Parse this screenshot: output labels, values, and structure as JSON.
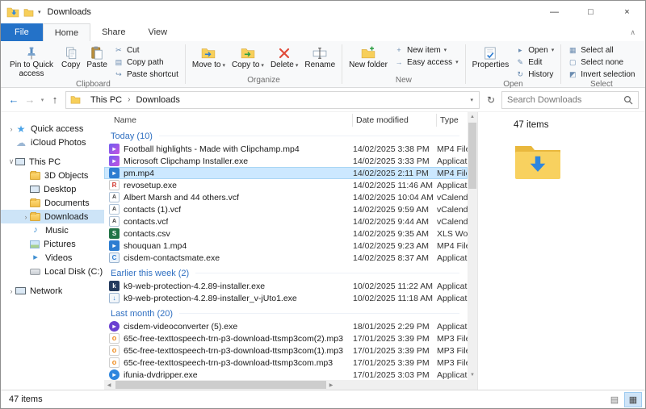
{
  "icons": {
    "dropdown": "▾",
    "crumb_sep": "›",
    "chevron_right": "›",
    "chevron_down": "∨",
    "back": "←",
    "forward": "→",
    "up": "↑",
    "refresh": "↻",
    "minimize": "—",
    "maximize": "□",
    "close": "×",
    "cut": "✂",
    "copy_path": "▤",
    "paste_shortcut": "↪",
    "new_item": "+",
    "easy_access": "→",
    "open": "▸",
    "edit": "✎",
    "history": "↻",
    "select_all": "▦",
    "select_none": "▢",
    "invert_selection": "◩",
    "scroll_up": "▲",
    "scroll_down": "▼",
    "scroll_left": "◀",
    "scroll_right": "▶",
    "ribbon_collapse": "∧",
    "details_view": "▤",
    "thumbnails_view": "▦"
  },
  "titlebar": {
    "title": "Downloads"
  },
  "tabs": {
    "file": "File",
    "items": [
      {
        "label": "Home",
        "active": true
      },
      {
        "label": "Share"
      },
      {
        "label": "View"
      }
    ]
  },
  "ribbon": {
    "clipboard": {
      "label": "Clipboard",
      "pin": "Pin to Quick access",
      "copy": "Copy",
      "paste": "Paste",
      "cut": "Cut",
      "copy_path": "Copy path",
      "paste_shortcut": "Paste shortcut"
    },
    "organize": {
      "label": "Organize",
      "move_to": "Move to",
      "copy_to": "Copy to",
      "delete": "Delete",
      "rename": "Rename"
    },
    "new": {
      "label": "New",
      "new_folder": "New folder",
      "new_item": "New item",
      "easy_access": "Easy access"
    },
    "open": {
      "label": "Open",
      "properties": "Properties",
      "open": "Open",
      "edit": "Edit",
      "history": "History"
    },
    "select": {
      "label": "Select",
      "select_all": "Select all",
      "select_none": "Select none",
      "invert": "Invert selection"
    }
  },
  "addressbar": {
    "crumbs": [
      "This PC",
      "Downloads"
    ],
    "search_placeholder": "Search Downloads"
  },
  "sidebar": {
    "items": [
      {
        "id": "quick-access",
        "label": "Quick access",
        "level": 1,
        "expand": "closed",
        "icon": "quick-access-star-icon",
        "ic": "ic-star",
        "glyph": "★"
      },
      {
        "id": "icloud-photos",
        "label": "iCloud Photos",
        "level": 1,
        "expand": "none",
        "icon": "cloud-icon",
        "ic": "ic-cloud",
        "glyph": "☁"
      },
      {
        "id": "this-pc",
        "label": "This PC",
        "level": 1,
        "expand": "open",
        "icon": "computer-icon",
        "ic": "ic-pc",
        "gap": true
      },
      {
        "id": "3d-objects",
        "label": "3D Objects",
        "level": 2,
        "expand": "none",
        "icon": "folder-icon",
        "ic": "ic-folder"
      },
      {
        "id": "desktop",
        "label": "Desktop",
        "level": 2,
        "expand": "none",
        "icon": "desktop-icon",
        "ic": "ic-pc"
      },
      {
        "id": "documents",
        "label": "Documents",
        "level": 2,
        "expand": "none",
        "icon": "documents-folder-icon",
        "ic": "ic-folder"
      },
      {
        "id": "downloads",
        "label": "Downloads",
        "level": 2,
        "expand": "closed",
        "icon": "downloads-folder-icon",
        "ic": "ic-folder",
        "selected": true
      },
      {
        "id": "music",
        "label": "Music",
        "level": 2,
        "expand": "none",
        "icon": "music-icon",
        "ic": "ic-music",
        "glyph": "♪"
      },
      {
        "id": "pictures",
        "label": "Pictures",
        "level": 2,
        "expand": "none",
        "icon": "pictures-icon",
        "ic": "ic-pic"
      },
      {
        "id": "videos",
        "label": "Videos",
        "level": 2,
        "expand": "none",
        "icon": "videos-icon",
        "ic": "ic-vid",
        "glyph": "▸"
      },
      {
        "id": "local-disk-c",
        "label": "Local Disk (C:)",
        "level": 2,
        "expand": "none",
        "icon": "disk-drive-icon",
        "ic": "ic-disk"
      },
      {
        "id": "network",
        "label": "Network",
        "level": 1,
        "expand": "closed",
        "icon": "network-icon",
        "ic": "ic-net",
        "gap": true
      }
    ]
  },
  "filelist": {
    "columns": [
      "Name",
      "Date modified",
      "Type"
    ],
    "groups": [
      {
        "label": "Today (10)",
        "files": [
          {
            "name": "Football highlights - Made with Clipchamp.mp4",
            "date": "14/02/2025 3:38 PM",
            "type": "MP4 File",
            "icon": "video-file-icon",
            "ic": "f-clip",
            "glyph": "▸"
          },
          {
            "name": "Microsoft Clipchamp Installer.exe",
            "date": "14/02/2025 3:33 PM",
            "type": "Application",
            "icon": "application-icon",
            "ic": "f-clip",
            "glyph": "▸"
          },
          {
            "name": "pm.mp4",
            "date": "14/02/2025 2:11 PM",
            "type": "MP4 File",
            "icon": "video-file-icon",
            "ic": "f-mp4",
            "glyph": "▸",
            "selected": true
          },
          {
            "name": "revosetup.exe",
            "date": "14/02/2025 11:46 AM",
            "type": "Application",
            "icon": "application-icon",
            "ic": "f-exe-red",
            "glyph": "R"
          },
          {
            "name": "Albert Marsh and 44 others.vcf",
            "date": "14/02/2025 10:04 AM",
            "type": "vCalendar F...",
            "icon": "contact-file-icon",
            "ic": "f-vcf",
            "glyph": "A"
          },
          {
            "name": "contacts (1).vcf",
            "date": "14/02/2025 9:59 AM",
            "type": "vCalendar F...",
            "icon": "contact-file-icon",
            "ic": "f-vcf",
            "glyph": "A"
          },
          {
            "name": "contacts.vcf",
            "date": "14/02/2025 9:44 AM",
            "type": "vCalendar F...",
            "icon": "contact-file-icon",
            "ic": "f-vcf",
            "glyph": "A"
          },
          {
            "name": "contacts.csv",
            "date": "14/02/2025 9:35 AM",
            "type": "XLS Worksh...",
            "icon": "spreadsheet-file-icon",
            "ic": "f-csv",
            "glyph": "S"
          },
          {
            "name": "shouquan 1.mp4",
            "date": "14/02/2025 9:23 AM",
            "type": "MP4 File",
            "icon": "video-file-icon",
            "ic": "f-mp4",
            "glyph": "▸"
          },
          {
            "name": "cisdem-contactsmate.exe",
            "date": "14/02/2025 8:37 AM",
            "type": "Application",
            "icon": "application-icon",
            "ic": "f-exe-blue",
            "glyph": "C"
          }
        ]
      },
      {
        "label": "Earlier this week (2)",
        "files": [
          {
            "name": "k9-web-protection-4.2.89-installer.exe",
            "date": "10/02/2025 11:22 AM",
            "type": "Application",
            "icon": "application-icon",
            "ic": "f-k9",
            "glyph": "k"
          },
          {
            "name": "k9-web-protection-4.2.89-installer_v-jUto1.exe",
            "date": "10/02/2025 11:18 AM",
            "type": "Application",
            "icon": "application-icon",
            "ic": "f-k9b",
            "glyph": "↓"
          }
        ]
      },
      {
        "label": "Last month (20)",
        "files": [
          {
            "name": "cisdem-videoconverter (5).exe",
            "date": "18/01/2025 2:29 PM",
            "type": "Application",
            "icon": "application-icon",
            "ic": "f-conv",
            "glyph": "▸"
          },
          {
            "name": "65c-free-texttospeech-trn-p3-download-ttsmp3com(2).mp3",
            "date": "17/01/2025 3:39 PM",
            "type": "MP3 File",
            "icon": "audio-file-icon",
            "ic": "f-mp3",
            "glyph": "o"
          },
          {
            "name": "65c-free-texttospeech-trn-p3-download-ttsmp3com(1).mp3",
            "date": "17/01/2025 3:39 PM",
            "type": "MP3 File",
            "icon": "audio-file-icon",
            "ic": "f-mp3",
            "glyph": "o"
          },
          {
            "name": "65c-free-texttospeech-trn-p3-download-ttsmp3com.mp3",
            "date": "17/01/2025 3:39 PM",
            "type": "MP3 File",
            "icon": "audio-file-icon",
            "ic": "f-mp3",
            "glyph": "o"
          },
          {
            "name": "ifunia-dvdripper.exe",
            "date": "17/01/2025 3:03 PM",
            "type": "Application",
            "icon": "application-icon",
            "ic": "f-ifunia",
            "glyph": "▸"
          }
        ]
      }
    ]
  },
  "preview": {
    "items_count": "47 items"
  },
  "statusbar": {
    "items_count": "47 items"
  }
}
